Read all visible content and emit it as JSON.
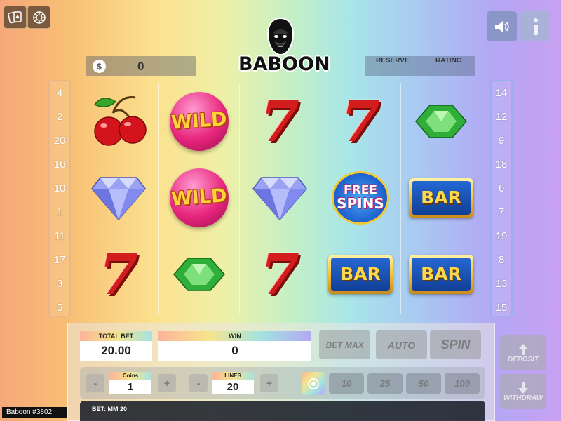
{
  "header": {
    "logo_text": "BABOON",
    "balance_value": "0",
    "reserve_label": "RESERVE",
    "rating_label": "RATING"
  },
  "left_numbers": [
    "4",
    "2",
    "20",
    "16",
    "10",
    "1",
    "11",
    "17",
    "3",
    "5"
  ],
  "right_numbers": [
    "14",
    "12",
    "9",
    "18",
    "6",
    "7",
    "19",
    "8",
    "13",
    "15"
  ],
  "reels": [
    [
      "cherry",
      "diamond",
      "seven"
    ],
    [
      "wild",
      "wild",
      "emerald"
    ],
    [
      "seven",
      "diamond",
      "seven"
    ],
    [
      "seven",
      "free-spins",
      "bar"
    ],
    [
      "emerald",
      "bar",
      "bar"
    ]
  ],
  "symbols": {
    "wild": "WILD",
    "seven": "7",
    "bar": "BAR",
    "free": "FREE",
    "spins": "SPINS"
  },
  "controls": {
    "total_bet_label": "TOTAL BET",
    "total_bet_value": "20.00",
    "win_label": "WIN",
    "win_value": "0",
    "bet_max_label": "BET MAX",
    "auto_label": "AUTO",
    "spin_label": "SPIN",
    "deposit_label": "DEPOSIT",
    "withdraw_label": "WITHDRAW",
    "coins_label": "Coins",
    "coins_value": "1",
    "lines_label": "LINES",
    "lines_value": "20",
    "minus": "-",
    "plus": "+",
    "denominations": [
      "10",
      "25",
      "50",
      "100"
    ],
    "bet_info": "BET: MM 20"
  },
  "footer": {
    "game_id": "Baboon #3802"
  },
  "colors": {
    "left_column_border": "#e9b58a",
    "right_column_border": "#9ab0ec",
    "speaker_button": "#8a96c8",
    "info_button": "#a9b1d8"
  }
}
